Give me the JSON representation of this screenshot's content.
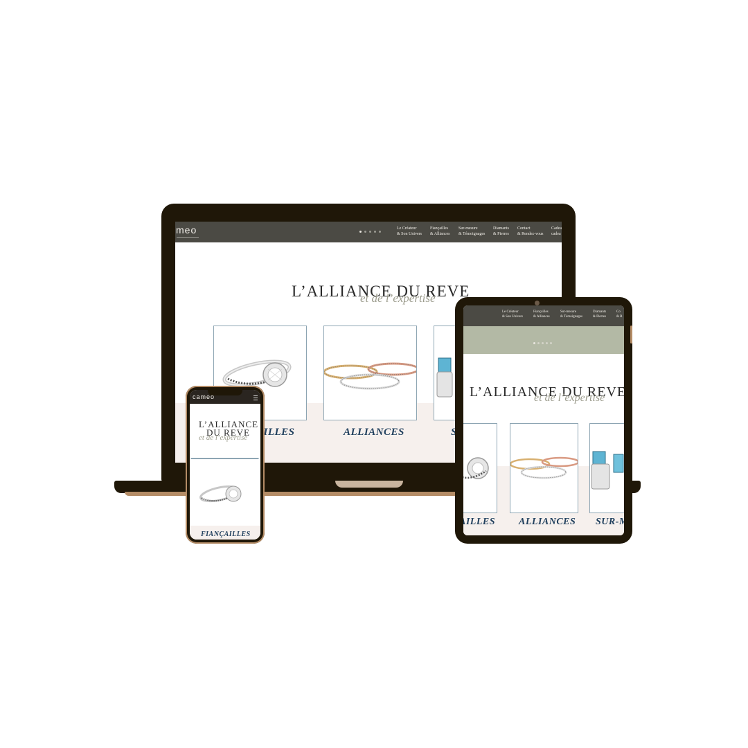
{
  "site": {
    "logo": "meo",
    "logo_phone": "cameo",
    "hero_title": "L’ALLIANCE DU REVE",
    "hero_title_line1": "L’ALLIANCE",
    "hero_title_line2": "DU REVE",
    "hero_subtitle": "et de l’expertise"
  },
  "nav": {
    "laptop_items": [
      "Le Créateur\n& Son Univers",
      "Fiançailles\n& Alliances",
      "Sur-mesure\n& Témoignages",
      "Diamants\n& Pierres",
      "Contact\n& Rendez-vous",
      "Cadea\ncadea"
    ],
    "tablet_items": [
      "Le Créateur\n& Son Univers",
      "Fiançailles\n& Alliances",
      "Sur-mesure\n& Témoignages",
      "Diamants\n& Pierres",
      "Co\n& R"
    ],
    "slider_dots": 5,
    "active_dot": 0
  },
  "cards": {
    "laptop_labels": [
      "AILLES",
      "ALLIANCES",
      "S"
    ],
    "tablet_labels": [
      "AILLES",
      "ALLIANCES",
      "SUR-M"
    ],
    "phone_label": "FIANÇAILLES"
  },
  "colors": {
    "device_frame": "#1f1708",
    "device_accent": "#b48c66",
    "navbar": "#4b4a44",
    "sage_band": "#b3b9a5",
    "pink_band": "#f6f0ed",
    "card_border": "#8da5b3",
    "label_blue": "#21405e"
  }
}
